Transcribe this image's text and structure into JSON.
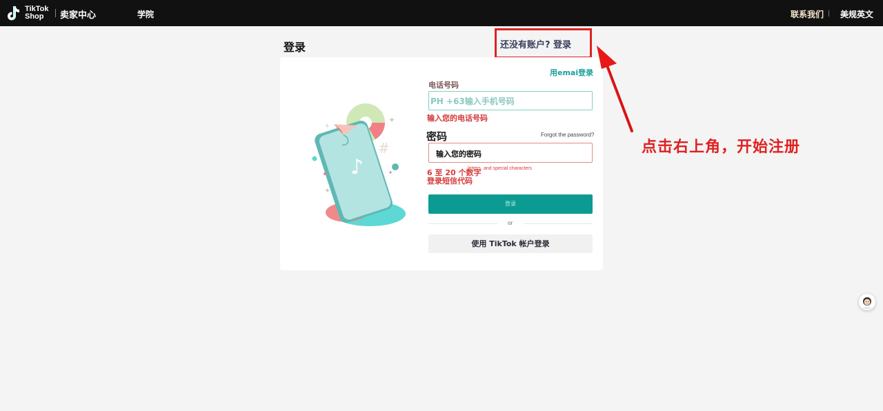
{
  "topbar": {
    "logo_line1": "TikTok",
    "logo_line2": "Shop",
    "seller_center": "卖家中心",
    "academy": "学院",
    "contact": "联系我们",
    "language": "美规英文"
  },
  "header": {
    "login_title": "登录",
    "signup_link": "还没有账户? 登录"
  },
  "form": {
    "email_login": "用emai登录",
    "phone_label": "电话号码",
    "phone_placeholder": "PH +63输入手机号码",
    "phone_error": "输入您的电话号码",
    "password_label": "密码",
    "forgot_password": "Forgot the password?",
    "password_placeholder": "输入您的密码",
    "password_hint_en": "letters, and special characters",
    "password_rule": "6 至 20 个数字",
    "sms_login": "登录短信代码",
    "login_button": "登录",
    "or": "or",
    "tiktok_login": "使用 TikTok 帐户登录"
  },
  "annotation": {
    "text": "点击右上角，开始注册"
  },
  "colors": {
    "topbar": "#111111",
    "accent_teal": "#0b9b93",
    "error_red": "#d63a3a",
    "annotation_red": "#e02020"
  }
}
